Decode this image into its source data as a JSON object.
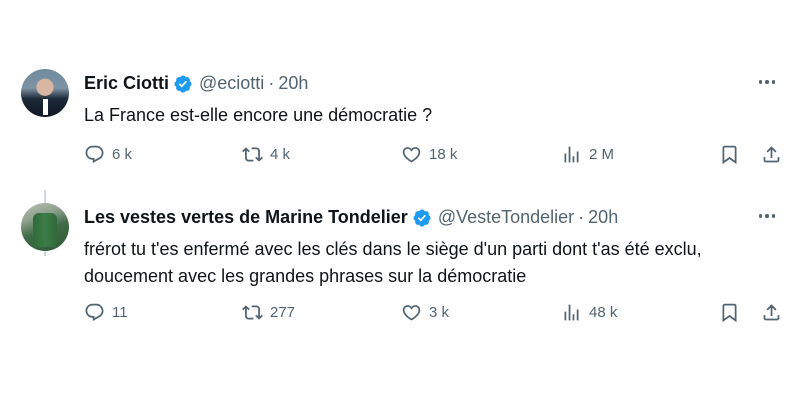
{
  "tweets": [
    {
      "name": "Eric Ciotti",
      "handle": "@eciotti",
      "dot": "·",
      "time": "20h",
      "text": "La France est-elle encore une démocratie ?",
      "replies": "6 k",
      "retweets": "4 k",
      "likes": "18 k",
      "views": "2 M"
    },
    {
      "name": "Les vestes vertes de Marine Tondelier",
      "handle": "@VesteTondelier",
      "dot": "·",
      "time": "20h",
      "text": "frérot tu t'es enfermé avec les clés dans le siège d'un parti dont t'as été exclu, doucement avec les grandes phrases sur la démocratie",
      "replies": "11",
      "retweets": "277",
      "likes": "3 k",
      "views": "48 k"
    }
  ],
  "icons": {
    "verified": "verified-badge-icon",
    "more": "more-icon",
    "reply": "reply-icon",
    "retweet": "retweet-icon",
    "like": "heart-icon",
    "views": "views-icon",
    "bookmark": "bookmark-icon",
    "share": "share-icon"
  },
  "colors": {
    "verified": "#1d9bf0",
    "text": "#0f1419",
    "secondary": "#536471",
    "thread_line": "#cfd9de"
  }
}
